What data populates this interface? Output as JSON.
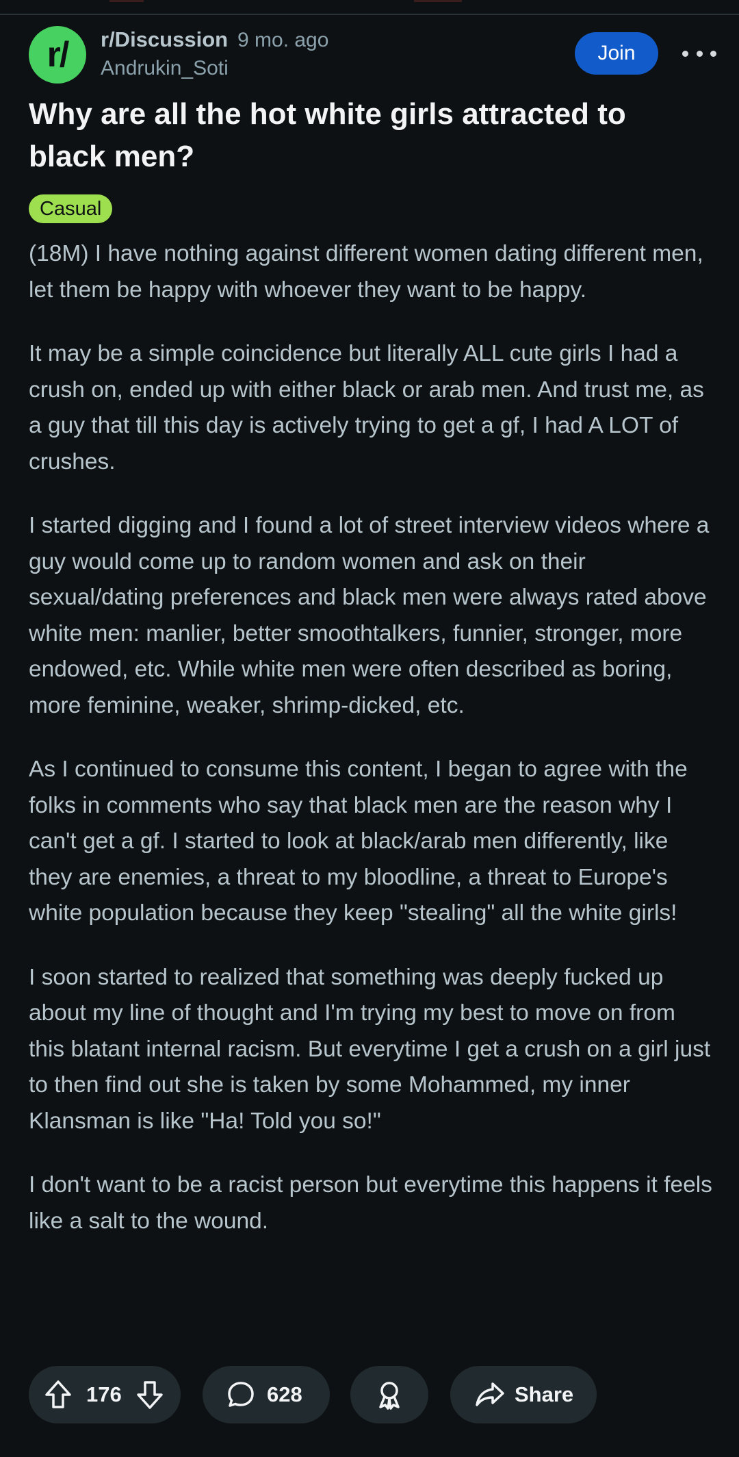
{
  "post": {
    "subreddit": "r/Discussion",
    "avatar_text": "r/",
    "time_ago": "9 mo. ago",
    "author": "Andrukin_Soti",
    "join_label": "Join",
    "title": "Why are all the hot white girls attracted to black men?",
    "flair": "Casual",
    "paragraphs": [
      "(18M) I have nothing against different women dating different men, let them be happy with whoever they want to be happy.",
      "It may be a simple coincidence but literally ALL cute girls I had a crush on, ended up with either black or arab men. And trust me, as a guy that till this day is actively trying to get a gf, I had A LOT of crushes.",
      "I started digging and I found a lot of street interview videos where a guy would come up to random women and ask on their sexual/dating preferences and black men were always rated above white men: manlier, better smoothtalkers, funnier, stronger, more endowed, etc. While white men were often described as boring, more feminine, weaker, shrimp-dicked, etc.",
      "As I continued to consume this content, I began to agree with the folks in comments who say that black men are the reason why I can't get a gf. I started to look at black/arab men differently, like they are enemies, a threat to my bloodline, a threat to Europe's white population because they keep \"stealing\" all the white girls!",
      "I soon started to realized that something was deeply fucked up about my line of thought and I'm trying my best to move on from this blatant internal racism. But everytime I get a crush on a girl just to then find out she is taken by some Mohammed, my inner Klansman is like \"Ha! Told you so!\"",
      "I don't want to be a racist person but everytime this happens it feels like a salt to the wound."
    ]
  },
  "actions": {
    "score": "176",
    "comments": "628",
    "share_label": "Share"
  },
  "colors": {
    "background": "#0e1113",
    "avatar": "#46d160",
    "join": "#115bca",
    "flair": "#9ddf4e",
    "pill": "#212a2e"
  },
  "icons": [
    "upvote-icon",
    "downvote-icon",
    "comment-icon",
    "award-icon",
    "share-icon",
    "more-icon"
  ]
}
